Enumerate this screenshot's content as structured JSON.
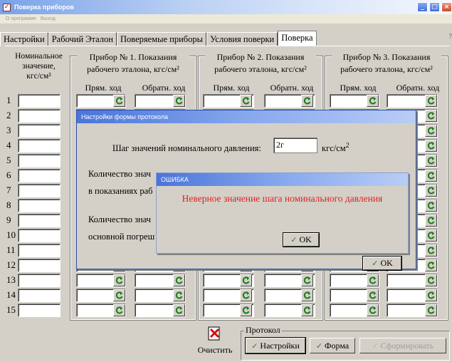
{
  "window": {
    "title": "Поверка приборов"
  },
  "menu": [
    "О программе",
    "Выход"
  ],
  "tabs": [
    "Настройки",
    "Рабочий Эталон",
    "Поверяемые приборы",
    "Условия поверки",
    "Поверка"
  ],
  "active_tab": 4,
  "side_mark": "?",
  "nominal_header": {
    "line1": "Номинальное",
    "line2": "значение,",
    "line3": "кгс/см²"
  },
  "groups": [
    {
      "title": "Прибор № 1.  Показания",
      "subtitle": "рабочего эталона, кгс/см²",
      "col1": "Прям. ход",
      "col2": "Обратн. ход"
    },
    {
      "title": "Прибор № 2.  Показания",
      "subtitle": "рабочего эталона, кгс/см²",
      "col1": "Прям. ход",
      "col2": "Обратн. ход"
    },
    {
      "title": "Прибор № 3.  Показания",
      "subtitle": "рабочего эталона, кгс/см²",
      "col1": "Прям. ход",
      "col2": "Обратн. ход"
    }
  ],
  "rows": [
    "1",
    "2",
    "3",
    "4",
    "5",
    "6",
    "7",
    "8",
    "9",
    "10",
    "11",
    "12",
    "13",
    "14",
    "15"
  ],
  "settings_dialog": {
    "title": "Настройки формы протокола",
    "step_label": "Шаг значений номинального давления:",
    "step_value": "2г",
    "step_unit": "кгс/см",
    "step_unit_sup": "2",
    "count_label_a1": "Количество знач",
    "count_label_a2": "в показаниях раб",
    "count_label_b1": "Количество знач",
    "count_label_b2": "основной погреш",
    "ok_label": "OK"
  },
  "error_dialog": {
    "title": "ОШИБКА",
    "message": "Неверное значение шага номинального давления",
    "ok_label": "OK",
    "message_color": "#e02020"
  },
  "bottom": {
    "clear_label": "Очистить",
    "protocol_label": "Протокол",
    "settings_btn": "Настройки",
    "form_btn": "Форма",
    "generate_btn": "Сформировать"
  }
}
